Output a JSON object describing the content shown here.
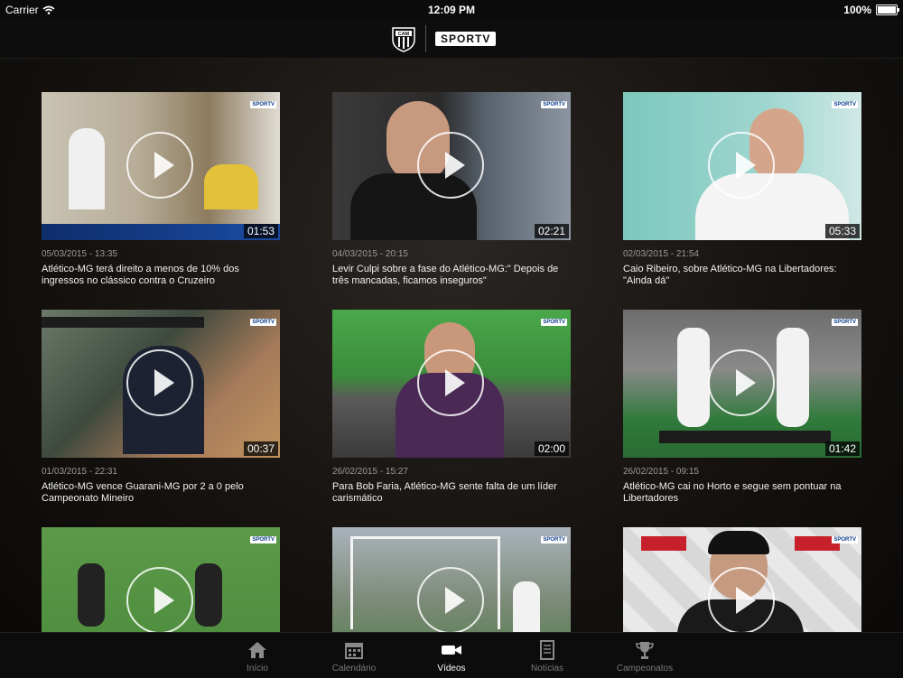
{
  "status_bar": {
    "carrier": "Carrier",
    "time": "12:09 PM",
    "battery": "100%"
  },
  "header": {
    "brand": "SPORTV",
    "crest": "CAM"
  },
  "videos": [
    {
      "date": "05/03/2015 - 13:35",
      "title": "Atlético-MG terá direito a menos de 10% dos ingressos no clássico contra o Cruzeiro",
      "duration": "01:53"
    },
    {
      "date": "04/03/2015 - 20:15",
      "title": "Levir Culpi sobre a fase do Atlético-MG:\" Depois de três mancadas, ficamos inseguros\"",
      "duration": "02:21"
    },
    {
      "date": "02/03/2015 - 21:54",
      "title": "Caio Ribeiro, sobre Atlético-MG na Libertadores: \"Ainda dá\"",
      "duration": "05:33"
    },
    {
      "date": "01/03/2015 - 22:31",
      "title": "Atlético-MG vence Guarani-MG por 2 a 0 pelo Campeonato Mineiro",
      "duration": "00:37"
    },
    {
      "date": "26/02/2015 - 15:27",
      "title": "Para Bob Faria, Atlético-MG sente falta de um líder carismático",
      "duration": "02:00"
    },
    {
      "date": "26/02/2015 - 09:15",
      "title": "Atlético-MG cai no Horto e segue sem pontuar na Libertadores",
      "duration": "01:42"
    },
    {
      "date": "",
      "title": "",
      "duration": ""
    },
    {
      "date": "",
      "title": "",
      "duration": ""
    },
    {
      "date": "",
      "title": "",
      "duration": ""
    }
  ],
  "tabs": [
    {
      "label": "Início",
      "icon": "home-icon"
    },
    {
      "label": "Calendário",
      "icon": "calendar-icon"
    },
    {
      "label": "Vídeos",
      "icon": "video-camera-icon",
      "active": true
    },
    {
      "label": "Notícias",
      "icon": "news-icon"
    },
    {
      "label": "Campeonatos",
      "icon": "trophy-icon"
    }
  ]
}
